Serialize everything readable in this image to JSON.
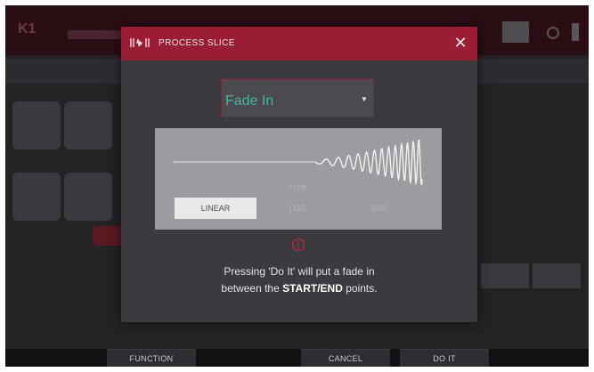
{
  "background": {
    "track_label": "K1"
  },
  "dialog": {
    "title": "PROCESS SLICE",
    "close_icon": "close-icon",
    "process_select": {
      "value": "Fade In"
    },
    "fade_types": [
      {
        "label": "LINEAR",
        "active": true
      },
      {
        "label": "LOG",
        "active": false
      },
      {
        "label": "EXP",
        "active": false
      }
    ],
    "fade_type_top_label": "TYPE",
    "message_line1": "Pressing 'Do It' will put a fade in",
    "message_line2_prefix": "between the ",
    "message_line2_bold": "START/END",
    "message_line2_suffix": " points."
  },
  "footer": {
    "function_label": "FUNCTION",
    "cancel_label": "CANCEL",
    "do_it_label": "DO IT"
  },
  "colors": {
    "accent": "#9a1d33",
    "select_text": "#41b8a4"
  }
}
